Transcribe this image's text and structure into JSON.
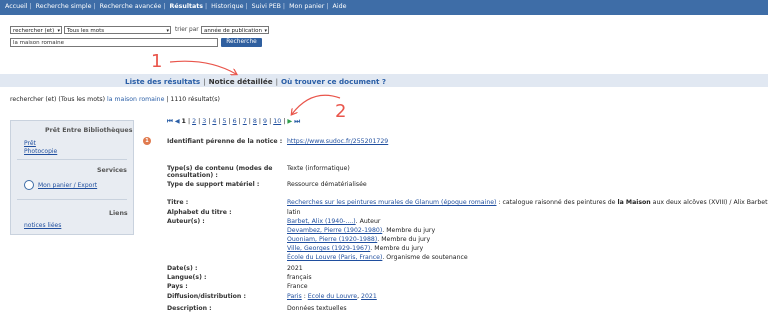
{
  "topnav": {
    "items": [
      "Accueil",
      "Recherche simple",
      "Recherche avancée",
      "Résultats",
      "Historique",
      "Suivi PEB",
      "Mon panier",
      "Aide"
    ]
  },
  "search": {
    "operator_select": "rechercher (et)",
    "field_select": "Tous les mots",
    "sort_label": "trier par",
    "sort_select": "année de publication",
    "query_value": "la maison romaine",
    "submit_label": "Recherche"
  },
  "tabs": {
    "list": "Liste des résultats",
    "detail": "Notice détaillée",
    "where": "Où trouver ce document ?",
    "sep": "|"
  },
  "annotations": {
    "one": "1",
    "two": "2",
    "accent_color": "#e9554b"
  },
  "summary": {
    "prefix": "rechercher (et) (Tous les mots)",
    "query": "la maison romaine",
    "count": "| 1110 résultat(s)"
  },
  "sidebar": {
    "peb_title": "Prêt Entre Bibliothèques",
    "peb_links": [
      "Prêt",
      "Photocopie"
    ],
    "services_title": "Services",
    "cart_link": "Mon panier / Export",
    "links_title": "Liens",
    "related_link": "notices liées"
  },
  "pager": {
    "first_icon": "first-page-icon",
    "prev_icon": "prev-page-icon",
    "current": "1",
    "pages": [
      "2",
      "3",
      "4",
      "5",
      "6",
      "7",
      "8",
      "9",
      "10"
    ],
    "sep": "|",
    "next_icon": "next-page-icon",
    "last_icon": "last-page-icon"
  },
  "record": {
    "number": "1",
    "permalink_label": "Identifiant pérenne de la notice :",
    "permalink": "https://www.sudoc.fr/255201729",
    "content_type_label_l1": "Type(s) de contenu (modes de",
    "content_type_label_l2": "consultation) :",
    "content_type": "Texte (informatique)",
    "support_label": "Type de support matériel :",
    "support": "Ressource dématérialisée",
    "title_label": "Titre :",
    "title_link": "Recherches sur les peintures murales de Glanum (époque romaine)",
    "title_rest_a": " : catalogue raisonné des peintures de ",
    "title_bold": "la Maison",
    "title_rest_b": " aux deux alcôves (XVIII) / Alix Barbet",
    "alphabet_label": "Alphabet du titre :",
    "alphabet": "latin",
    "authors_label": "Auteur(s) :",
    "authors": [
      {
        "name": "Barbet, Alix (1940-....)",
        "role": ". Auteur"
      },
      {
        "name": "Devambez, Pierre (1902-1980)",
        "role": ". Membre du jury"
      },
      {
        "name": "Ouoniam, Pierre (1920-1988)",
        "role": ". Membre du jury"
      },
      {
        "name": "Ville, Georges (1929-1967)",
        "role": ". Membre du jury"
      },
      {
        "name": "École du Louvre (Paris, France)",
        "role": ". Organisme de soutenance"
      }
    ],
    "dates_label": "Date(s) :",
    "dates": "2021",
    "language_label": "Langue(s) :",
    "language": "français",
    "country_label": "Pays :",
    "country": "France",
    "distribution_label": "Diffusion/distribution :",
    "distribution_a": "Paris",
    "distribution_sep1": " : ",
    "distribution_b": "Ecole du Louvre",
    "distribution_sep2": ", ",
    "distribution_c": "2021",
    "description_label": "Description :",
    "description": "Données textuelles"
  }
}
